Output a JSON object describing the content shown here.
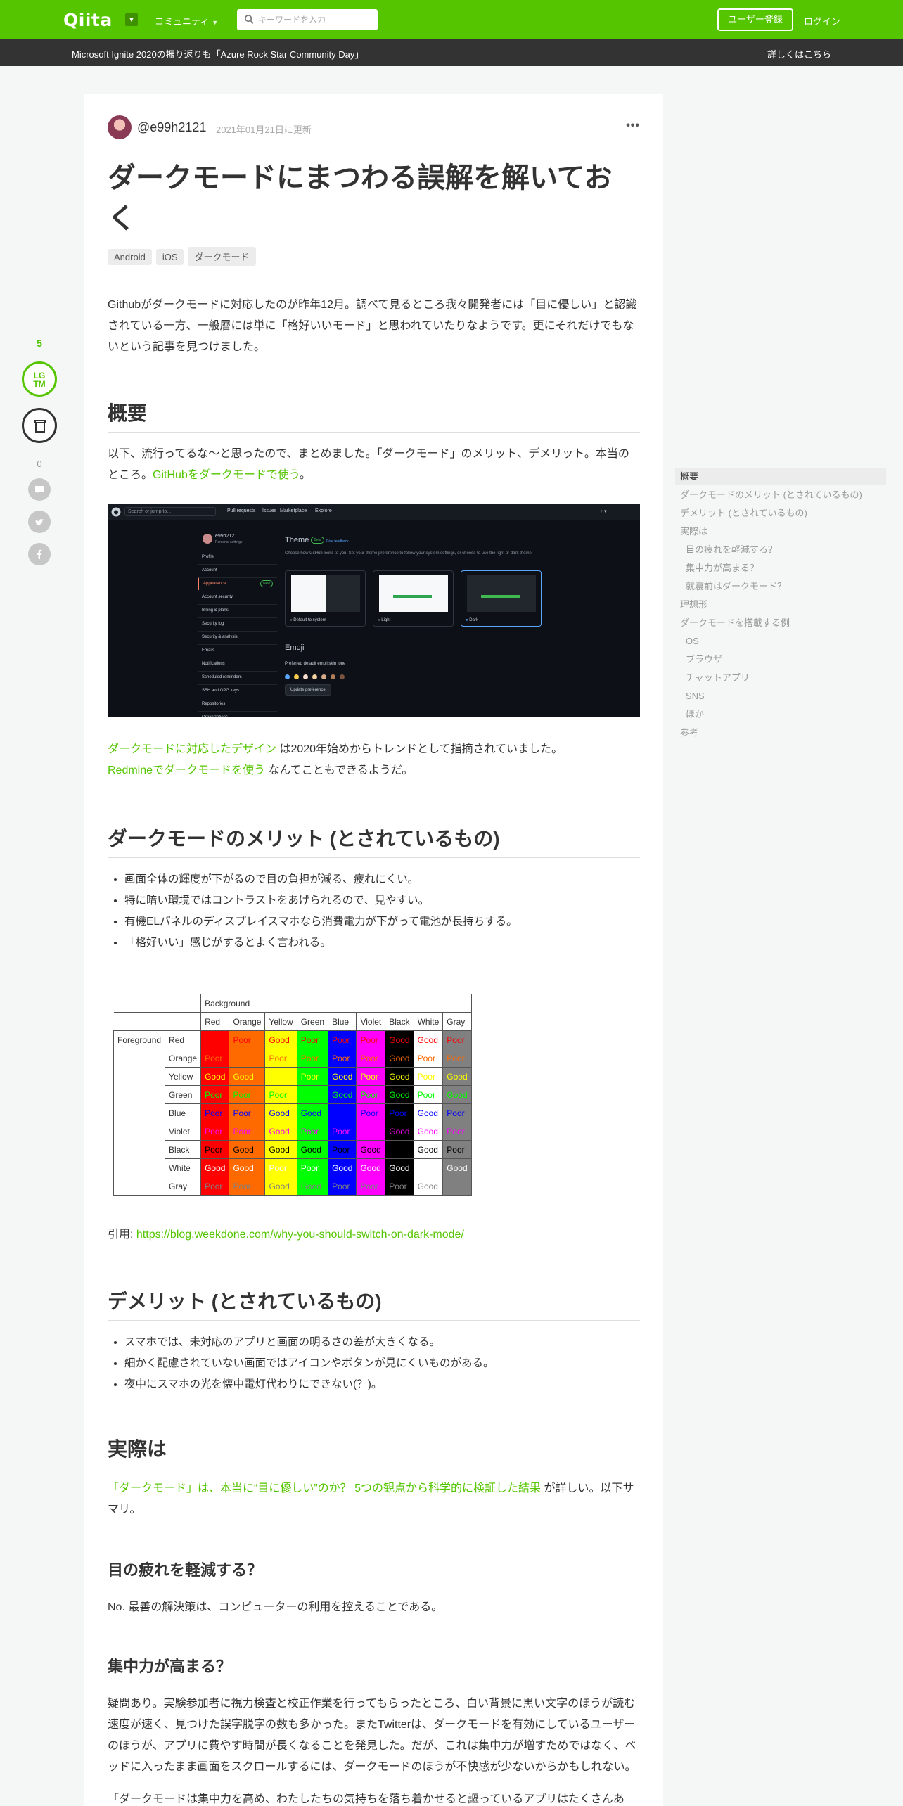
{
  "header": {
    "logo": "Qiita",
    "community": "コミュニティ",
    "search_placeholder": "キーワードを入力",
    "signup": "ユーザー登録",
    "login": "ログイン"
  },
  "announce": {
    "message": "Microsoft Ignite 2020の振り返りも「Azure Rock Star Community Day」",
    "more": "詳しくはこちら"
  },
  "rail": {
    "likes": "5",
    "lgtm_line1": "LG",
    "lgtm_line2": "TM",
    "comments": "0"
  },
  "article": {
    "author": "@e99h2121",
    "updated": "2021年01月21日に更新",
    "more": "•••",
    "title": "ダークモードにまつわる誤解を解いておく",
    "tags": [
      "Android",
      "iOS",
      "ダークモード"
    ],
    "intro": "Githubがダークモードに対応したのが昨年12月。調べて見るところ我々開発者には「目に優しい」と認識されている一方、一般層には単に「格好いいモード」と思われていたりなようです。更にそれだけでもないという記事を見つけました。",
    "h_overview": "概要",
    "overview_text": "以下、流行ってるな～と思ったので、まとめました。「ダークモード」のメリット、デメリット。本当のところ。",
    "overview_link": "GitHubをダークモードで使う",
    "overview_end": "。",
    "trend_link": "ダークモードに対応したデザイン",
    "trend_text": " は2020年始めからトレンドとして指摘されていました。",
    "redmine_link": "Redmineでダークモードを使う",
    "redmine_text": " なんてこともできるようだ。",
    "h_merit": "ダークモードのメリット (とされているもの)",
    "merits": [
      "画面全体の輝度が下がるので目の負担が減る、疲れにくい。",
      "特に暗い環境ではコントラストをあげられるので、見やすい。",
      "有機ELパネルのディスプレイスマホなら消費電力が下がって電池が長持ちする。",
      "「格好いい」感じがするとよく言われる。"
    ],
    "quote_prefix": "引用: ",
    "quote_link": "https://blog.weekdone.com/why-you-should-switch-on-dark-mode/",
    "h_demerit": "デメリット (とされているもの)",
    "demerits": [
      "スマホでは、未対応のアプリと画面の明るさの差が大きくなる。",
      "細かく配慮されていない画面ではアイコンやボタンが見にくいものがある。",
      "夜中にスマホの光を懐中電灯代わりにできない(？)。"
    ],
    "h_reality": "実際は",
    "reality_link": "「ダークモード」は、本当に“目に優しい”のか？ 5つの観点から科学的に検証した結果",
    "reality_text": " が詳しい。以下サマリ。",
    "h_eye": "目の疲れを軽減する？",
    "eye_text": "No. 最善の解決策は、コンピューターの利用を控えることである。",
    "h_focus": "集中力が高まる？",
    "focus_text": "疑問あり。実験参加者に視力検査と校正作業を行ってもらったところ、白い背景に黒い文字のほうが読む速度が速く、見つけた誤字脱字の数も多かった。またTwitterは、ダークモードを有効にしているユーザーのほうが、アプリに費やす時間が長くなることを発見した。だが、これは集中力が増すためではなく、ベッドに入ったまま画面をスクロールするには、ダークモードのほうが不快感が少ないからかもしれない。",
    "focus_text2": "「ダークモードは集中力を高め、わたしたちの気持ちを落ち着かせると謳っているアプリはたくさんあ"
  },
  "screenshot": {
    "search": "Search or jump to...",
    "nav": [
      "Pull requests",
      "Issues",
      "Marketplace",
      "Explore"
    ],
    "user": "e99h2121",
    "user_sub": "Personal settings",
    "menu": [
      "Profile",
      "Account",
      "Appearance",
      "Account security",
      "Billing & plans",
      "Security log",
      "Security & analysis",
      "Emails",
      "Notifications",
      "Scheduled reminders",
      "SSH and GPG keys",
      "Repositories",
      "Organizations"
    ],
    "new_badge": "New",
    "theme_title": "Theme",
    "beta": "Beta",
    "feedback": "Give feedback",
    "theme_desc": "Choose how GitHub looks to you. Set your theme preference to follow your system settings, or choose to use the light or dark theme.",
    "themes": [
      "Default to system",
      "Light",
      "Dark"
    ],
    "emoji_title": "Emoji",
    "emoji_desc": "Preferred default emoji skin tone",
    "update_btn": "Update preference"
  },
  "contrast_table": {
    "background_label": "Background",
    "foreground_label": "Foreground",
    "colors": [
      "Red",
      "Orange",
      "Yellow",
      "Green",
      "Blue",
      "Violet",
      "Black",
      "White",
      "Gray"
    ],
    "hex": [
      "#ff0000",
      "#ff6a00",
      "#ffff00",
      "#00ff00",
      "#0000ff",
      "#ff00ff",
      "#000000",
      "#ffffff",
      "#808080"
    ],
    "rows": [
      [
        "",
        "Poor",
        "Good",
        "Poor",
        "Poor",
        "Poor",
        "Good",
        "Good",
        "Poor"
      ],
      [
        "Poor",
        "",
        "Poor",
        "Poor",
        "Poor",
        "Poor",
        "Good",
        "Poor",
        "Poor"
      ],
      [
        "Good",
        "Good",
        "",
        "Poor",
        "Good",
        "Poor",
        "Good",
        "Poor",
        "Good"
      ],
      [
        "Poor",
        "Poor",
        "Poor",
        "",
        "Good",
        "Poor",
        "Good",
        "Poor",
        "Good"
      ],
      [
        "Poor",
        "Poor",
        "Good",
        "Good",
        "",
        "Poor",
        "Poor",
        "Good",
        "Poor"
      ],
      [
        "Poor",
        "Poor",
        "Good",
        "Poor",
        "Poor",
        "",
        "Good",
        "Good",
        "Poor"
      ],
      [
        "Poor",
        "Good",
        "Good",
        "Good",
        "Poor",
        "Good",
        "",
        "Good",
        "Poor"
      ],
      [
        "Good",
        "Good",
        "Poor",
        "Poor",
        "Good",
        "Good",
        "Good",
        "",
        "Good"
      ],
      [
        "Poor",
        "Poor",
        "Good",
        "Good",
        "Poor",
        "Poor",
        "Poor",
        "Good",
        ""
      ]
    ]
  },
  "toc": [
    {
      "label": "概要",
      "level": 1,
      "active": true
    },
    {
      "label": "ダークモードのメリット (とされているもの)",
      "level": 1
    },
    {
      "label": "デメリット (とされているもの)",
      "level": 1
    },
    {
      "label": "実際は",
      "level": 1
    },
    {
      "label": "目の疲れを軽減する？",
      "level": 2
    },
    {
      "label": "集中力が高まる？",
      "level": 2
    },
    {
      "label": "就寝前はダークモード？",
      "level": 2
    },
    {
      "label": "理想形",
      "level": 1
    },
    {
      "label": "ダークモードを搭載する例",
      "level": 1
    },
    {
      "label": "OS",
      "level": 2
    },
    {
      "label": "ブラウザ",
      "level": 2
    },
    {
      "label": "チャットアプリ",
      "level": 2
    },
    {
      "label": "SNS",
      "level": 2
    },
    {
      "label": "ほか",
      "level": 2
    },
    {
      "label": "参考",
      "level": 1
    }
  ],
  "colors": {
    "brand": "#55c500",
    "announce_bg": "#333333"
  }
}
